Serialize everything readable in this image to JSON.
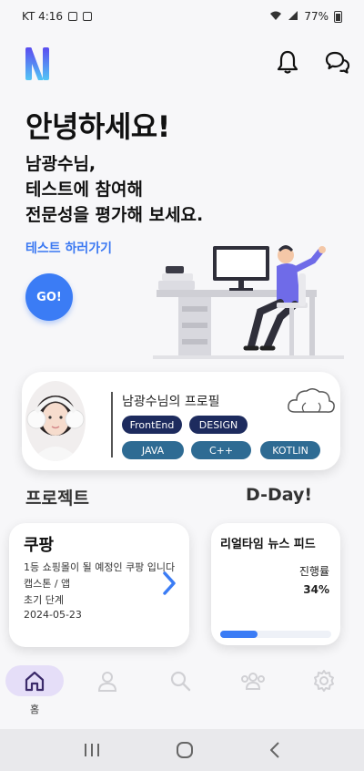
{
  "status": {
    "carrier_time": "KT 4:16",
    "battery": "77%"
  },
  "greeting": "안녕하세요!",
  "subtitle": {
    "line1": "남광수님,",
    "line2": "테스트에 참여해",
    "line3": "전문성을 평가해 보세요."
  },
  "test_link": "테스트 하러가기",
  "go_button": "GO!",
  "profile": {
    "title": "남광수님의 프로필",
    "tags": [
      "FrontEnd",
      "DESIGN",
      "JAVA",
      "C++",
      "KOTLIN"
    ]
  },
  "sections": {
    "projects": "프로젝트",
    "dday": "D-Day!"
  },
  "project": {
    "name": "쿠팡",
    "description": "1등 쇼핑몰이 될 예정인 쿠팡 입니다",
    "type": "캡스톤 / 앱",
    "stage": "초기 단계",
    "date": "2024-05-23"
  },
  "news": {
    "title": "리얼타임 뉴스 피드",
    "progress_label": "진행률",
    "progress_value": "34%",
    "progress_fraction": 0.34
  },
  "nav": {
    "items": [
      {
        "icon": "home-icon",
        "label": "홈"
      },
      {
        "icon": "user-icon",
        "label": ""
      },
      {
        "icon": "search-icon",
        "label": ""
      },
      {
        "icon": "group-icon",
        "label": ""
      },
      {
        "icon": "gear-icon",
        "label": ""
      }
    ]
  },
  "colors": {
    "accent": "#3b7cf5",
    "tag_dark": "#1d2b5e",
    "tag_teal": "#2e6b93",
    "nav_active": "#e5def8"
  }
}
